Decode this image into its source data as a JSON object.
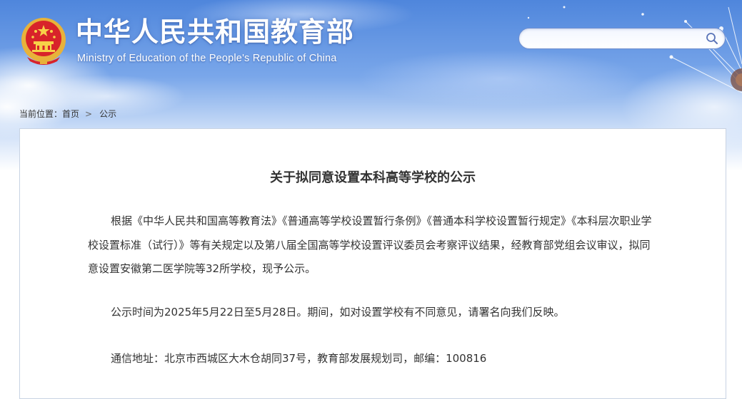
{
  "header": {
    "title": "中华人民共和国教育部",
    "subtitle": "Ministry of Education of the People's Republic of China"
  },
  "search": {
    "value": "",
    "placeholder": ""
  },
  "breadcrumb": {
    "prefix": "当前位置：",
    "home": "首页",
    "separator": ">",
    "current": "公示"
  },
  "article": {
    "title": "关于拟同意设置本科高等学校的公示",
    "paragraphs": [
      "根据《中华人民共和国高等教育法》《普通高等学校设置暂行条例》《普通本科学校设置暂行规定》《本科层次职业学校设置标准（试行）》等有关规定以及第八届全国高等学校设置评议委员会考察评议结果，经教育部党组会议审议，拟同意设置安徽第二医学院等32所学校，现予公示。",
      "公示时间为2025年5月22日至5月28日。期间，如对设置学校有不同意见，请署名向我们反映。",
      "通信地址：北京市西城区大木仓胡同37号，教育部发展规划司，邮编：100816"
    ]
  },
  "icons": {
    "emblem": "national-emblem-icon",
    "search": "search-icon"
  },
  "colors": {
    "header_sky": "#5b8fe0",
    "text": "#333333",
    "border": "#c8d3e3",
    "search_border": "#6f8fd0"
  }
}
